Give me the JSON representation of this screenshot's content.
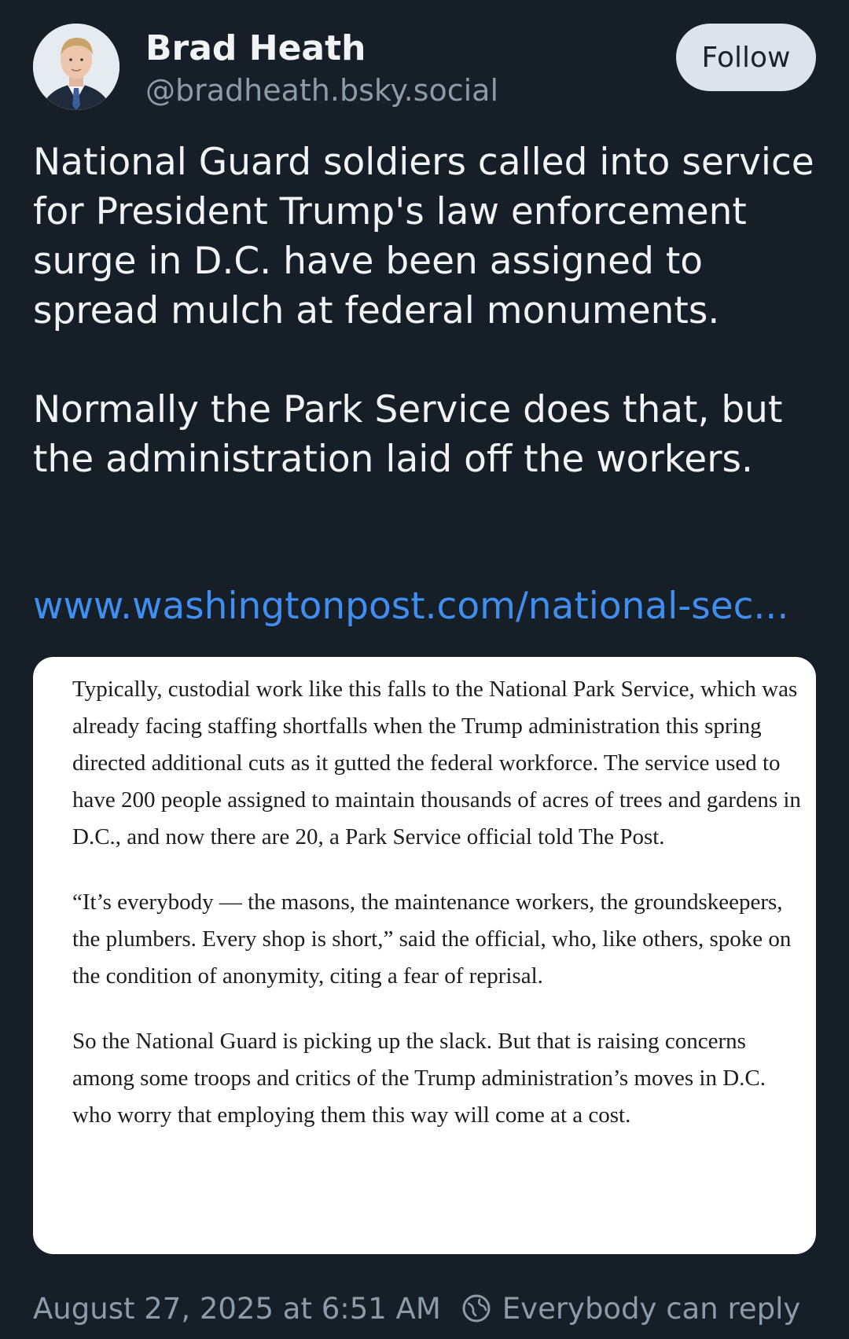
{
  "author": {
    "name": "Brad Heath",
    "handle": "@bradheath.bsky.social"
  },
  "follow_button": {
    "label": "Follow"
  },
  "post": {
    "paragraphs": [
      "National Guard soldiers called into service for President Trump's law enforcement surge in D.C. have been assigned to spread mulch at federal monuments.",
      "Normally the Park Service does that, but the administration laid off the workers."
    ],
    "link_text": "www.washingtonpost.com/national-sec..."
  },
  "embedded_image": {
    "paragraphs": [
      "Typically, custodial work like this falls to the National Park Service, which was already facing staffing shortfalls when the Trump administration this spring directed additional cuts as it gutted the federal workforce. The service used to have 200 people assigned to maintain thousands of acres of trees and gardens in D.C., and now there are 20, a Park Service official told The Post.",
      "“It’s everybody — the masons, the maintenance workers, the groundskeepers, the plumbers. Every shop is short,” said the official, who, like others, spoke on the condition of anonymity, citing a fear of reprisal.",
      "So the National Guard is picking up the slack. But that is raising concerns among some troops and critics of the Trump administration’s moves in D.C. who worry that employing them this way will come at a cost."
    ]
  },
  "footer": {
    "timestamp": "August 27, 2025 at 6:51 AM",
    "reply_setting": "Everybody can reply",
    "reply_icon": "globe-icon"
  },
  "colors": {
    "background": "#161e27",
    "text_primary": "#f1f3f5",
    "text_secondary": "#8d9aa8",
    "link": "#3f8ef0",
    "follow_button_bg": "#dde3ea"
  }
}
